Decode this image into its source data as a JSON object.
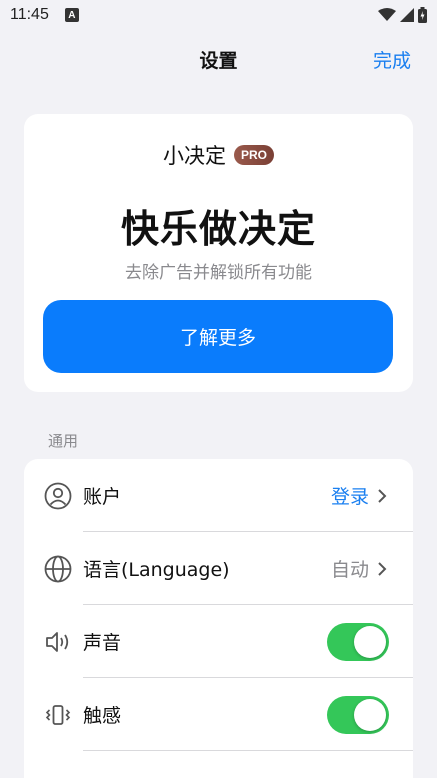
{
  "status_bar": {
    "time": "11:45",
    "notification": "A"
  },
  "nav": {
    "title": "设置",
    "done_label": "完成"
  },
  "pro_card": {
    "app_name": "小决定",
    "badge": "PRO",
    "headline": "快乐做决定",
    "subtitle": "去除广告并解锁所有功能",
    "button_label": "了解更多"
  },
  "general": {
    "section_label": "通用",
    "rows": [
      {
        "icon": "person-circle-icon",
        "label": "账户",
        "value": "登录"
      },
      {
        "icon": "globe-icon",
        "label": "语言(Language)",
        "value": "自动"
      },
      {
        "icon": "speaker-icon",
        "label": "声音",
        "toggle_on": true
      },
      {
        "icon": "vibration-icon",
        "label": "触感",
        "toggle_on": true
      }
    ]
  },
  "colors": {
    "accent": "#1a7ff0",
    "button": "#0a7cfc",
    "toggle_on": "#34c759",
    "background": "#f2f2f6"
  }
}
